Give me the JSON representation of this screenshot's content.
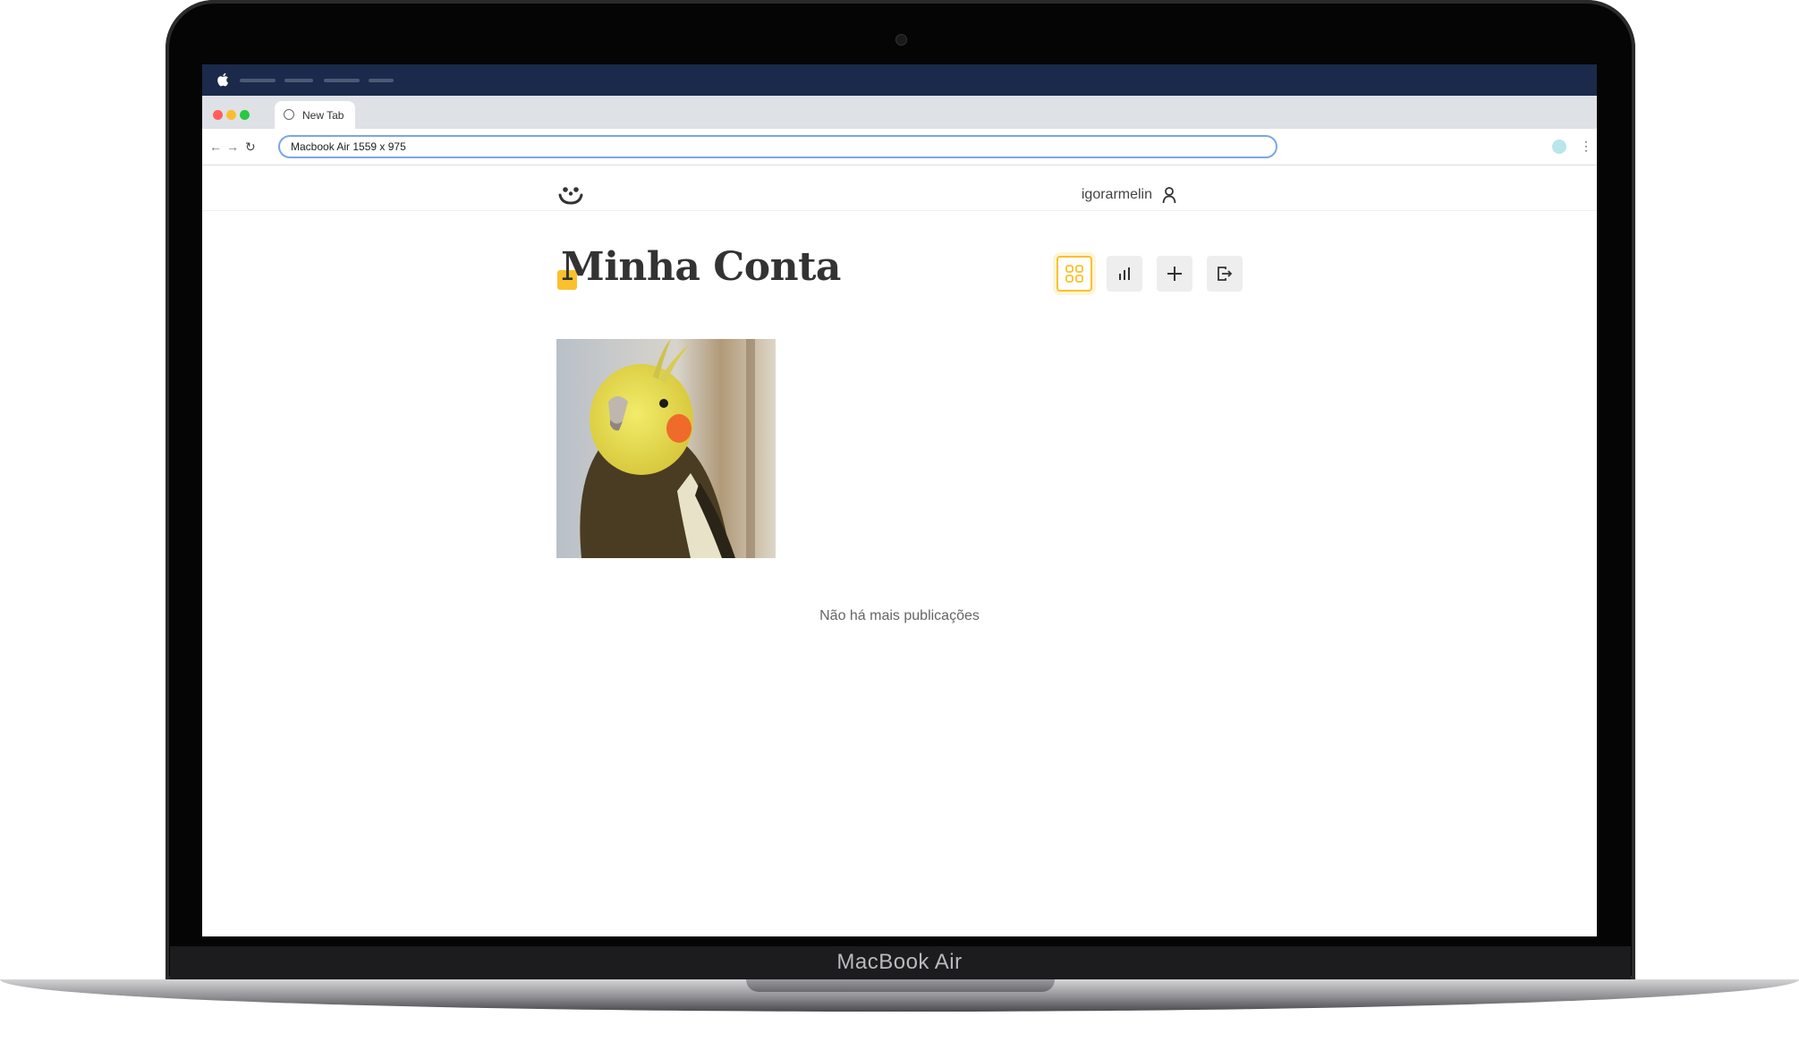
{
  "device": {
    "label": "MacBook Air"
  },
  "browser": {
    "tab_title": "New Tab",
    "address_text": "Macbook Air   1559 x 975"
  },
  "site": {
    "user": {
      "name": "igorarmelin",
      "icon": "user-icon"
    },
    "page_title": "Minha Conta",
    "accent_color": "#fbc02d",
    "actions": [
      {
        "name": "feed-grid-button",
        "icon": "grid-icon",
        "active": true
      },
      {
        "name": "stats-button",
        "icon": "bar-chart-icon",
        "active": false
      },
      {
        "name": "new-post-button",
        "icon": "plus-icon",
        "active": false
      },
      {
        "name": "logout-button",
        "icon": "logout-icon",
        "active": false
      }
    ],
    "photos": [
      {
        "subject": "cockatiel"
      }
    ],
    "empty_message": "Não há mais publicações"
  }
}
